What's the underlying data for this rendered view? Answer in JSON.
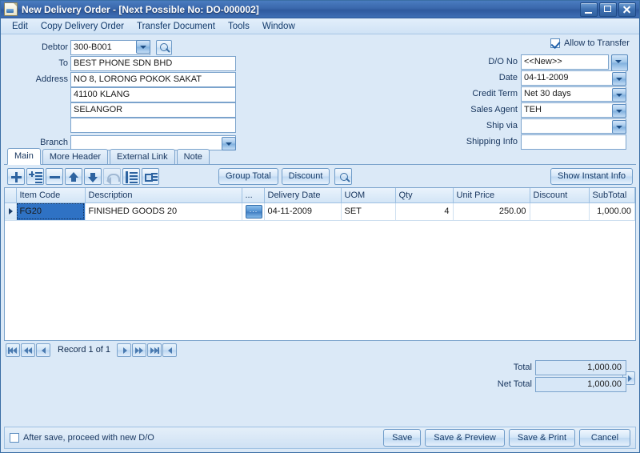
{
  "window": {
    "title": "New Delivery Order - [Next Possible No: DO-000002]",
    "minimize_label": "Minimize",
    "maximize_label": "Maximize",
    "close_label": "Close"
  },
  "menu": {
    "items": [
      {
        "label": "Edit"
      },
      {
        "label": "Copy Delivery Order"
      },
      {
        "label": "Transfer Document"
      },
      {
        "label": "Tools"
      },
      {
        "label": "Window"
      }
    ]
  },
  "header_left": {
    "debtor_label": "Debtor",
    "debtor_value": "300-B001",
    "to_label": "To",
    "to_value": "BEST PHONE SDN BHD",
    "address_label": "Address",
    "address_line1": "NO 8, LORONG POKOK SAKAT",
    "address_line2": "41100 KLANG",
    "address_line3": "SELANGOR",
    "address_line4": "",
    "branch_label": "Branch",
    "branch_value": ""
  },
  "header_right": {
    "allow_transfer_label": "Allow to Transfer",
    "allow_transfer_checked": true,
    "do_no_label": "D/O No",
    "do_no_value": "<<New>>",
    "date_label": "Date",
    "date_value": "04-11-2009",
    "credit_term_label": "Credit Term",
    "credit_term_value": "Net 30 days",
    "sales_agent_label": "Sales Agent",
    "sales_agent_value": "TEH",
    "ship_via_label": "Ship via",
    "ship_via_value": "",
    "shipping_info_label": "Shipping Info",
    "shipping_info_value": ""
  },
  "tabs": [
    {
      "label": "Main",
      "active": true
    },
    {
      "label": "More Header",
      "active": false
    },
    {
      "label": "External Link",
      "active": false
    },
    {
      "label": "Note",
      "active": false
    }
  ],
  "grid_toolbar": {
    "buttons": [
      {
        "icon": "add-row-icon",
        "enabled": true
      },
      {
        "icon": "insert-row-icon",
        "enabled": true
      },
      {
        "icon": "delete-row-icon",
        "enabled": true
      },
      {
        "icon": "move-up-icon",
        "enabled": true
      },
      {
        "icon": "move-down-icon",
        "enabled": true
      },
      {
        "icon": "undo-icon",
        "enabled": false
      },
      {
        "icon": "list-view-icon",
        "enabled": true
      },
      {
        "icon": "detail-view-icon",
        "enabled": true
      }
    ],
    "group_total_label": "Group Total",
    "discount_label": "Discount",
    "search_icon": "magnifier-icon",
    "show_instant_info_label": "Show Instant Info"
  },
  "grid": {
    "columns": [
      "Item Code",
      "Description",
      "...",
      "Delivery Date",
      "UOM",
      "Qty",
      "Unit Price",
      "Discount",
      "SubTotal"
    ],
    "rows": [
      {
        "selected": true,
        "item_code": "FG20",
        "description": "FINISHED GOODS 20",
        "dots": "...",
        "delivery_date": "04-11-2009",
        "uom": "SET",
        "qty": "4",
        "unit_price": "250.00",
        "discount": "",
        "subtotal": "1,000.00"
      }
    ]
  },
  "navigator": {
    "record_text": "Record 1 of 1",
    "first_label": "First",
    "prev_page_label": "Previous page",
    "prev_label": "Previous",
    "next_label": "Next",
    "next_page_label": "Next page",
    "last_label": "Last",
    "collapse_label": "Collapse"
  },
  "totals": {
    "total_label": "Total",
    "total_value": "1,000.00",
    "net_total_label": "Net Total",
    "net_total_value": "1,000.00"
  },
  "footer": {
    "after_save_label": "After save, proceed with new D/O",
    "after_save_checked": false,
    "save_label": "Save",
    "save_preview_label": "Save & Preview",
    "save_print_label": "Save & Print",
    "cancel_label": "Cancel"
  },
  "colors": {
    "titlebar": "#3a68ac",
    "background": "#dbe9f7",
    "selection": "#2f72c4",
    "field_border": "#7ba3cc"
  }
}
